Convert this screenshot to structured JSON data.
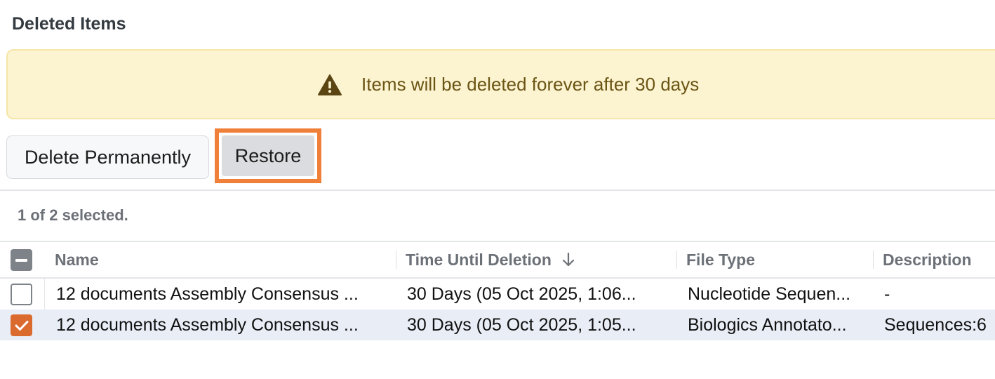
{
  "page": {
    "title": "Deleted Items",
    "banner_text": "Items will be deleted forever after 30 days"
  },
  "toolbar": {
    "delete_label": "Delete Permanently",
    "restore_label": "Restore"
  },
  "selection": {
    "text": "1 of 2 selected."
  },
  "table": {
    "columns": [
      "Name",
      "Time Until Deletion",
      "File Type",
      "Description"
    ],
    "sort": {
      "column": "Time Until Deletion",
      "direction": "descending"
    },
    "rows": [
      {
        "checked": false,
        "name": "12 documents Assembly Consensus ...",
        "time": "30 Days (05 Oct 2025, 1:06...",
        "type": "Nucleotide Sequen...",
        "description": "-"
      },
      {
        "checked": true,
        "name": "12 documents Assembly Consensus ...",
        "time": "30 Days (05 Oct 2025, 1:05...",
        "type": "Biologics Annotato...",
        "description": "Sequences:6"
      }
    ]
  },
  "icons": {
    "warning": "warning-triangle-icon",
    "sort": "arrow-down-icon",
    "select_all": "indeterminate-checkbox-icon"
  },
  "colors": {
    "accent": "#f07f3a",
    "checkbox_checked": "#db6a2e",
    "banner_bg": "#fcf3d1",
    "banner_text": "#6b5514",
    "selected_row": "#e8edf6"
  }
}
